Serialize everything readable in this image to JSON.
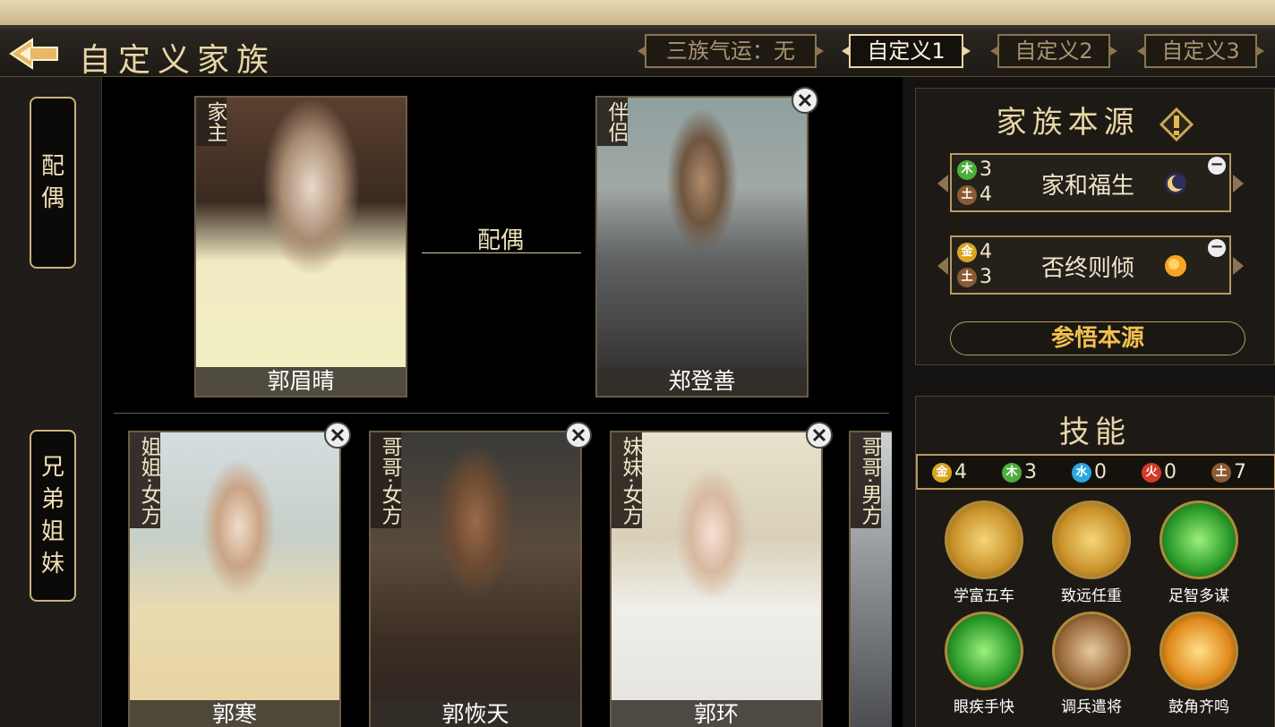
{
  "header": {
    "title": "自定义家族",
    "tabs": [
      {
        "label": "三族气运：无"
      },
      {
        "label": "自定义1"
      },
      {
        "label": "自定义2"
      },
      {
        "label": "自定义3"
      }
    ],
    "active_tab": 1
  },
  "sidebar": {
    "items": [
      {
        "label": [
          "配",
          "偶"
        ]
      },
      {
        "label": [
          "兄",
          "弟",
          "姐",
          "妹"
        ]
      }
    ]
  },
  "spouse_section": {
    "link_label": "配偶",
    "head": {
      "role": "家主",
      "name": "郭眉晴"
    },
    "partner": {
      "role": "伴侣",
      "name": "郑登善"
    }
  },
  "siblings": [
    {
      "role": "姐姐·女方",
      "name": "郭寒"
    },
    {
      "role": "哥哥·女方",
      "name": "郭恢天"
    },
    {
      "role": "妹妹·女方",
      "name": "郭环"
    },
    {
      "role": "哥哥·男方",
      "name": ""
    }
  ],
  "family_source": {
    "title": "家族本源",
    "items": [
      {
        "name": "家和福生",
        "elements": [
          {
            "el": "木",
            "count": "3"
          },
          {
            "el": "土",
            "count": "4"
          }
        ],
        "icon": "moon-icon"
      },
      {
        "name": "否终则倾",
        "elements": [
          {
            "el": "金",
            "count": "4"
          },
          {
            "el": "土",
            "count": "3"
          }
        ],
        "icon": "sun-icon"
      }
    ],
    "comprehend_label": "参悟本源"
  },
  "skills": {
    "title": "技能",
    "element_counts": [
      {
        "el": "金",
        "count": "4"
      },
      {
        "el": "木",
        "count": "3"
      },
      {
        "el": "水",
        "count": "0"
      },
      {
        "el": "火",
        "count": "0"
      },
      {
        "el": "土",
        "count": "7"
      }
    ],
    "list": [
      {
        "name": "学富五车"
      },
      {
        "name": "致远任重"
      },
      {
        "name": "足智多谋"
      },
      {
        "name": "眼疾手快"
      },
      {
        "name": "调兵遣将"
      },
      {
        "name": "鼓角齐鸣"
      }
    ]
  },
  "colors": {
    "gold": "#e8d6a6",
    "metal": "#d9a51f",
    "wood": "#4caf3a",
    "water": "#2aa8e0",
    "fire": "#d63a2a",
    "earth": "#8a5a32"
  }
}
